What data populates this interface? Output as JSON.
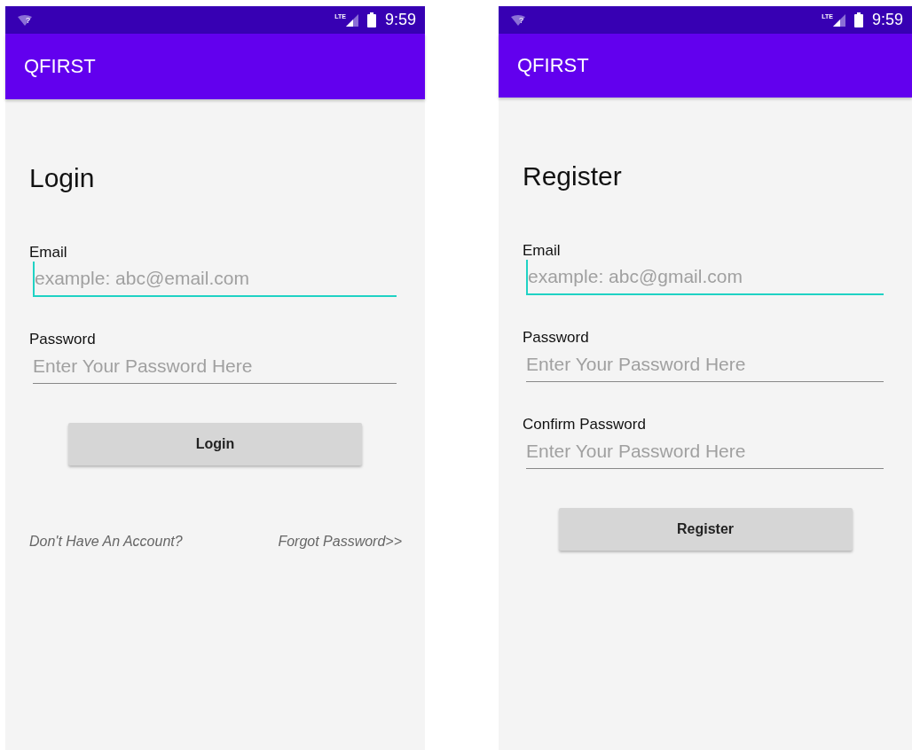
{
  "screens": [
    {
      "status_bar": {
        "wifi_mark": "?",
        "network": "LTE",
        "time": "9:59"
      },
      "app_bar": {
        "title": "QFIRST"
      },
      "heading": "Login",
      "fields": [
        {
          "label": "Email",
          "placeholder": "example: abc@email.com",
          "focused": true
        },
        {
          "label": "Password",
          "placeholder": "Enter Your Password Here",
          "focused": false
        }
      ],
      "button": "Login",
      "links": [
        "Don't Have An Account?",
        "Forgot Password>>"
      ]
    },
    {
      "status_bar": {
        "wifi_mark": "?",
        "network": "LTE",
        "time": "9:59"
      },
      "app_bar": {
        "title": "QFIRST"
      },
      "heading": "Register",
      "fields": [
        {
          "label": "Email",
          "placeholder": "example: abc@gmail.com",
          "focused": true
        },
        {
          "label": "Password",
          "placeholder": "Enter Your Password Here",
          "focused": false
        },
        {
          "label": "Confirm Password",
          "placeholder": "Enter Your Password Here",
          "focused": false
        }
      ],
      "button": "Register"
    }
  ]
}
